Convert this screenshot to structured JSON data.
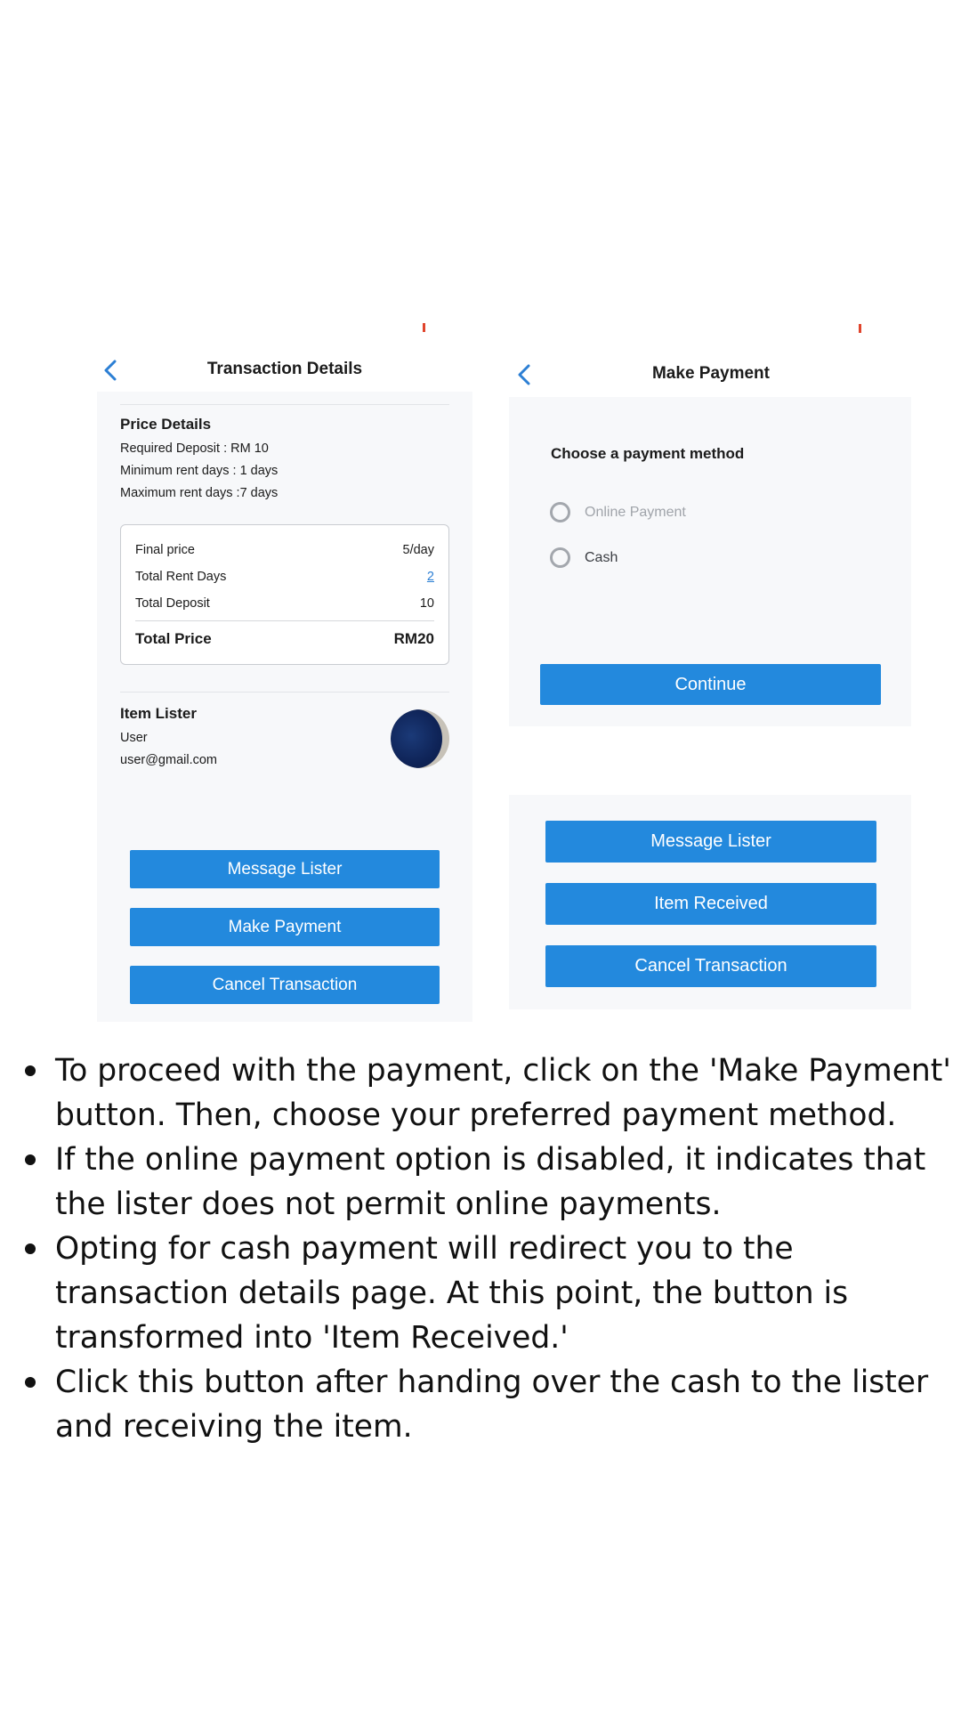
{
  "left_screen": {
    "title": "Transaction Details",
    "price_details": {
      "heading": "Price Details",
      "lines": [
        "Required Deposit : RM 10",
        "Minimum rent days : 1 days",
        "Maximum rent days :7 days"
      ]
    },
    "price_box": {
      "rows": [
        {
          "label": "Final price",
          "value": "5/day"
        },
        {
          "label": "Total Rent Days",
          "value": "2"
        },
        {
          "label": "Total Deposit",
          "value": "10"
        }
      ],
      "total": {
        "label": "Total Price",
        "value": "RM20"
      }
    },
    "item_lister": {
      "heading": "Item Lister",
      "name": "User",
      "email": "user@gmail.com"
    },
    "buttons": [
      "Message Lister",
      "Make Payment",
      "Cancel Transaction"
    ]
  },
  "right_screen": {
    "title": "Make Payment",
    "prompt": "Choose a payment method",
    "options": [
      {
        "label": "Online Payment",
        "disabled": true
      },
      {
        "label": "Cash",
        "disabled": false
      }
    ],
    "continue_label": "Continue",
    "buttons": [
      "Message Lister",
      "Item Received",
      "Cancel Transaction"
    ]
  },
  "instructions": [
    "To proceed with the payment, click on the 'Make Payment' button. Then, choose your preferred payment method.",
    "If the online payment option is disabled, it indicates that the lister does not permit online payments.",
    "Opting for cash payment will redirect you to the transaction details page. At this point, the button is transformed into 'Item Received.'",
    "Click this button after handing over the cash to the lister and receiving the item."
  ],
  "colors": {
    "accent_blue": "#2389dd",
    "link_blue": "#2c7fd4",
    "panel_bg": "#f7f8fa",
    "status_tick": "#e0442c"
  },
  "icons": {
    "back": "chevron-left-icon",
    "radio": "radio-unchecked-icon"
  }
}
